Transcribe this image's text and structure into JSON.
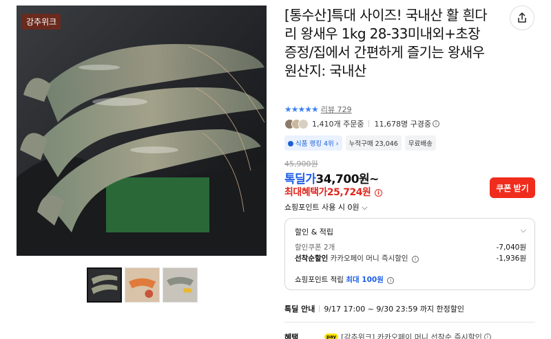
{
  "brand_badge": "강추위크",
  "title": "[통수산]특대 사이즈! 국내산 활 흰다리 왕새우 1kg 28-33미내외+초장증정/집에서 간편하게 즐기는 왕새우 원산지: 국내산",
  "rating": {
    "stars": "★★★★★",
    "review": "리뷰 729"
  },
  "buyers": {
    "orders": "1,410개 주문중",
    "subscribers": "11,678명 구경중",
    "info": "i"
  },
  "tags": {
    "ranking": "식품 랭킹 4위 ›",
    "cumulative": "누적구매 23,046",
    "shipping": "무료배송"
  },
  "price": {
    "original": "45,900원",
    "deal_label": "톡딜가",
    "deal_value": "34,700원~",
    "max_label": "최대혜택가",
    "max_value": "25,724원",
    "info": "i"
  },
  "coupon_button": "쿠폰 받기",
  "points_use": "쇼핑포인트 사용 시 0원 ⌵",
  "benefit_box": {
    "heading": "할인 & 적립",
    "chevron": "⌵",
    "row1_label": "할인쿠폰 2개",
    "row1_value": "-7,040원",
    "row2_label_strong": "선착순할인",
    "row2_label_sub": "카카오페이 머니 즉시할인",
    "row2_info": "i",
    "row2_value": "-1,936원",
    "points_label": "쇼핑포인트 적립",
    "points_value": "최대 100원",
    "points_info": "i"
  },
  "deal_info": {
    "label": "톡딜 안내",
    "text": "9/17 17:00 ~ 9/30 23:59 까지 한정할인"
  },
  "benefit": {
    "label": "혜택",
    "kpay": "pay",
    "text": "[강추위크] 카카오페이 머니 선착순 즉시할인",
    "info": "i"
  },
  "colors": {
    "accent_blue": "#1f5ee8",
    "accent_red": "#e0281f",
    "coupon_red": "#f02c1d"
  }
}
